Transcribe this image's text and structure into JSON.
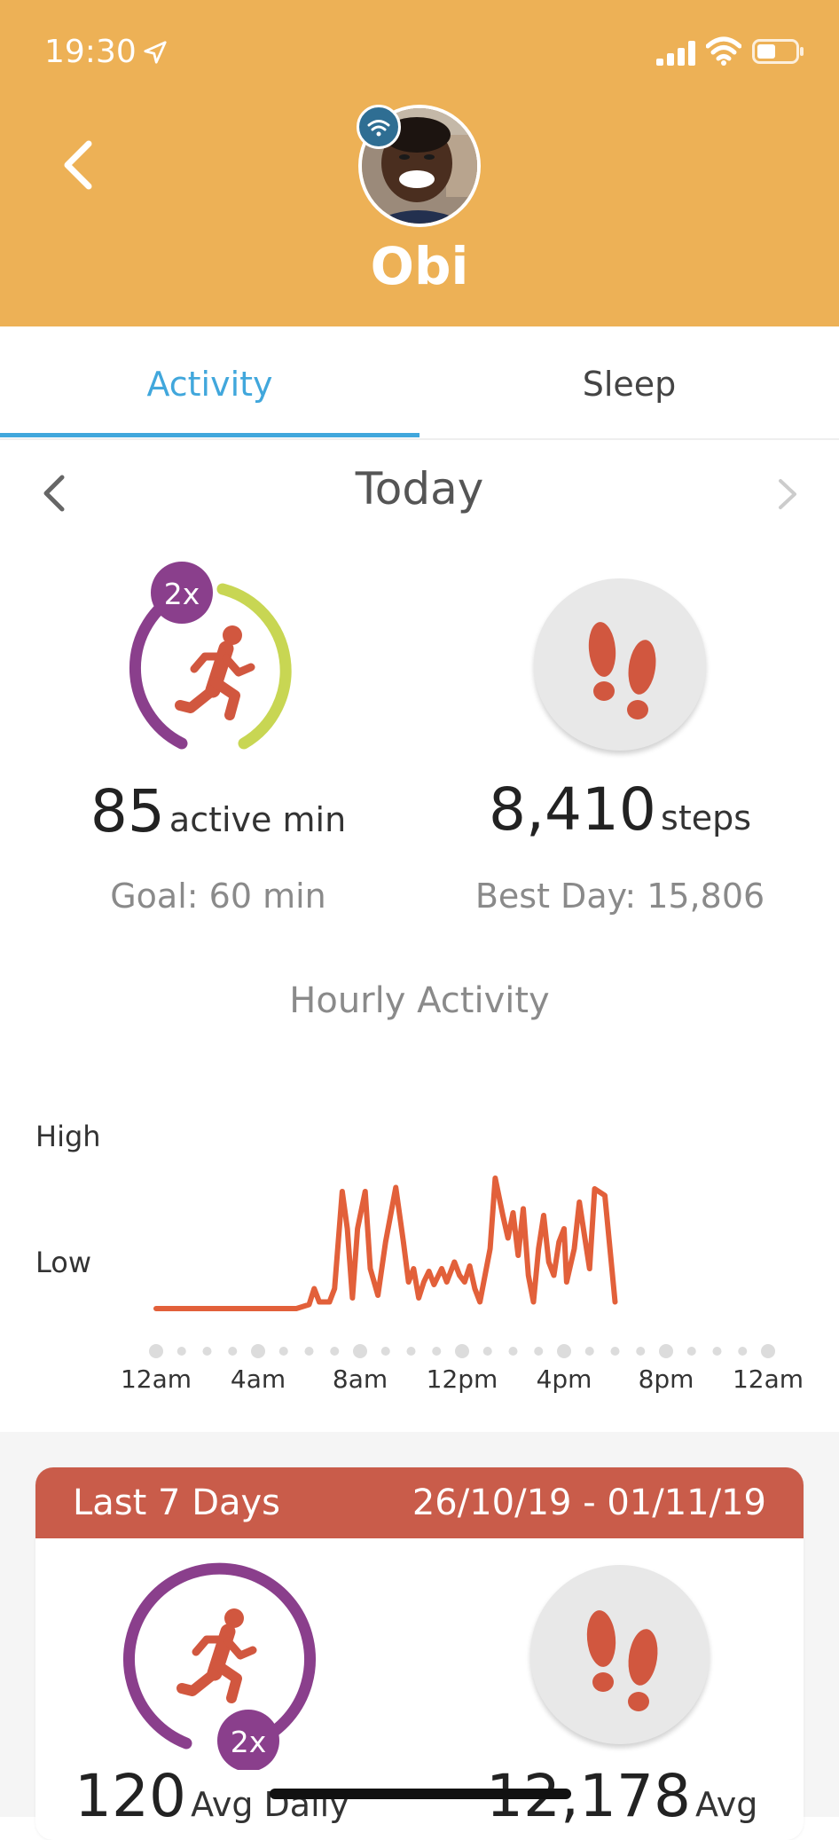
{
  "status_bar": {
    "time": "19:30"
  },
  "header": {
    "child_name": "Obi",
    "background": "#edb156"
  },
  "tabs": [
    {
      "label": "Activity",
      "active": true
    },
    {
      "label": "Sleep",
      "active": false
    }
  ],
  "date_nav": {
    "label": "Today"
  },
  "today": {
    "active_multiplier": "2x",
    "active_value": "85",
    "active_unit": "active min",
    "active_goal": "Goal: 60 min",
    "steps_value": "8,410",
    "steps_unit": "steps",
    "steps_best": "Best Day: 15,806"
  },
  "hourly": {
    "title": "Hourly Activity",
    "y_high": "High",
    "y_low": "Low",
    "line_color": "#e2603a"
  },
  "chart_data": {
    "type": "line",
    "title": "Hourly Activity",
    "xlabel": "",
    "ylabel": "",
    "x_tick_labels": [
      "12am",
      "4am",
      "8am",
      "12pm",
      "4pm",
      "8pm",
      "12am"
    ],
    "y_tick_labels": [
      "High",
      "Low"
    ],
    "xlim": [
      0,
      24
    ],
    "ylim": [
      0,
      1
    ],
    "series": [
      {
        "values": [
          [
            0,
            0
          ],
          [
            5.5,
            0
          ],
          [
            6.0,
            0.03
          ],
          [
            6.2,
            0.15
          ],
          [
            6.4,
            0.05
          ],
          [
            6.8,
            0.05
          ],
          [
            7.0,
            0.15
          ],
          [
            7.3,
            0.88
          ],
          [
            7.5,
            0.6
          ],
          [
            7.7,
            0.08
          ],
          [
            7.9,
            0.6
          ],
          [
            8.2,
            0.88
          ],
          [
            8.4,
            0.3
          ],
          [
            8.7,
            0.1
          ],
          [
            9.0,
            0.5
          ],
          [
            9.4,
            0.91
          ],
          [
            9.7,
            0.5
          ],
          [
            9.9,
            0.2
          ],
          [
            10.1,
            0.3
          ],
          [
            10.3,
            0.08
          ],
          [
            10.5,
            0.2
          ],
          [
            10.7,
            0.28
          ],
          [
            10.9,
            0.18
          ],
          [
            11.2,
            0.3
          ],
          [
            11.4,
            0.2
          ],
          [
            11.7,
            0.35
          ],
          [
            11.9,
            0.25
          ],
          [
            12.1,
            0.2
          ],
          [
            12.3,
            0.32
          ],
          [
            12.5,
            0.15
          ],
          [
            12.7,
            0.05
          ],
          [
            13.1,
            0.45
          ],
          [
            13.3,
            0.98
          ],
          [
            13.6,
            0.7
          ],
          [
            13.8,
            0.53
          ],
          [
            14.0,
            0.72
          ],
          [
            14.2,
            0.4
          ],
          [
            14.4,
            0.75
          ],
          [
            14.6,
            0.25
          ],
          [
            14.8,
            0.05
          ],
          [
            15.0,
            0.45
          ],
          [
            15.2,
            0.7
          ],
          [
            15.4,
            0.35
          ],
          [
            15.6,
            0.25
          ],
          [
            15.8,
            0.5
          ],
          [
            16.0,
            0.6
          ],
          [
            16.1,
            0.2
          ],
          [
            16.4,
            0.45
          ],
          [
            16.6,
            0.8
          ],
          [
            16.8,
            0.55
          ],
          [
            17.0,
            0.3
          ],
          [
            17.2,
            0.9
          ],
          [
            17.6,
            0.85
          ],
          [
            18.0,
            0.05
          ]
        ]
      }
    ],
    "grid": false,
    "legend": "none"
  },
  "week_card": {
    "title": "Last 7 Days",
    "date_range": "26/10/19 - 01/11/19",
    "header_color": "#c95c4a",
    "active_multiplier": "2x",
    "active_value": "120",
    "active_unit": "Avg Daily",
    "steps_value": "12,178",
    "steps_unit": "Avg"
  },
  "colors": {
    "accent": "#41a7dc",
    "ring_purple": "#8a3f8c",
    "ring_green": "#c8d653",
    "icon_red": "#d1573f"
  },
  "icons": [
    "location-arrow-icon",
    "signal-icon",
    "wifi-icon",
    "battery-icon",
    "back-chevron-icon",
    "runner-icon",
    "footprints-icon"
  ]
}
